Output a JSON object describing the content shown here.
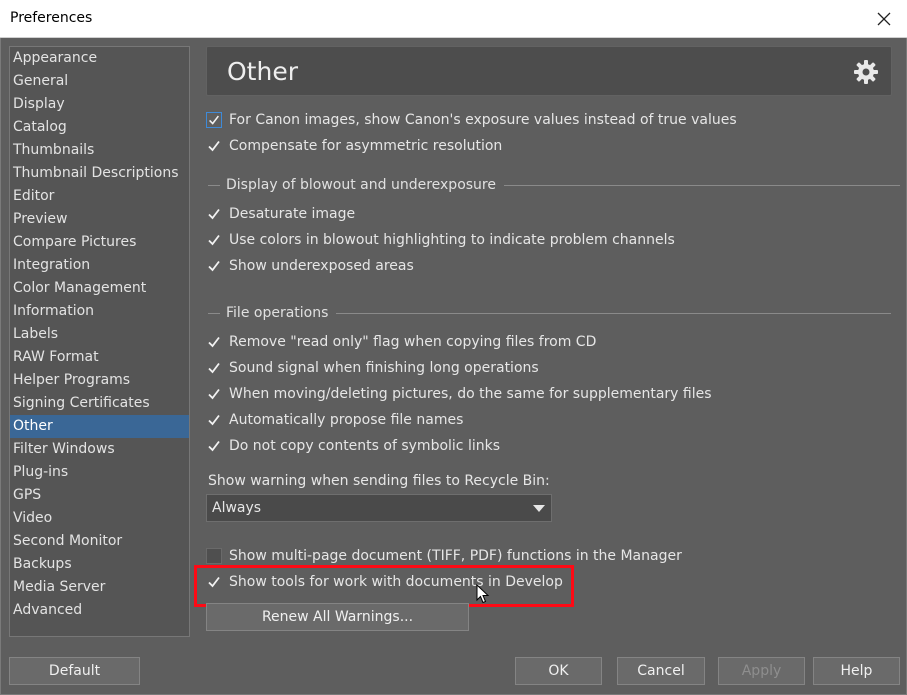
{
  "window": {
    "title": "Preferences"
  },
  "sidebar": {
    "items": [
      {
        "label": "Appearance"
      },
      {
        "label": "General"
      },
      {
        "label": "Display"
      },
      {
        "label": "Catalog"
      },
      {
        "label": "Thumbnails"
      },
      {
        "label": "Thumbnail Descriptions"
      },
      {
        "label": "Editor"
      },
      {
        "label": "Preview"
      },
      {
        "label": "Compare Pictures"
      },
      {
        "label": "Integration"
      },
      {
        "label": "Color Management"
      },
      {
        "label": "Information"
      },
      {
        "label": "Labels"
      },
      {
        "label": "RAW Format"
      },
      {
        "label": "Helper Programs"
      },
      {
        "label": "Signing Certificates"
      },
      {
        "label": "Other",
        "selected": true
      },
      {
        "label": "Filter Windows"
      },
      {
        "label": "Plug-ins"
      },
      {
        "label": "GPS"
      },
      {
        "label": "Video"
      },
      {
        "label": "Second Monitor"
      },
      {
        "label": "Backups"
      },
      {
        "label": "Media Server"
      },
      {
        "label": "Advanced"
      }
    ]
  },
  "header": {
    "title": "Other",
    "icon": "gear-icon"
  },
  "options": {
    "canon_exposure": {
      "label": "For Canon images, show Canon's exposure values instead of true values",
      "checked": true
    },
    "asymmetric": {
      "label": "Compensate for asymmetric resolution",
      "checked": true
    }
  },
  "blowout": {
    "heading": "Display of blowout and underexposure",
    "desaturate": {
      "label": "Desaturate image",
      "checked": true
    },
    "use_colors": {
      "label": "Use colors in blowout highlighting to indicate problem channels",
      "checked": true
    },
    "underexposed": {
      "label": "Show underexposed areas",
      "checked": true
    }
  },
  "fileops": {
    "heading": "File operations",
    "read_only": {
      "label": "Remove \"read only\" flag when copying files from CD",
      "checked": true
    },
    "sound": {
      "label": "Sound signal when finishing long operations",
      "checked": true
    },
    "supplementary": {
      "label": "When moving/deleting pictures, do the same for supplementary files",
      "checked": true
    },
    "propose_names": {
      "label": "Automatically propose file names",
      "checked": true
    },
    "symlinks": {
      "label": "Do not copy contents of symbolic links",
      "checked": true
    }
  },
  "recycle": {
    "label": "Show warning when sending files to Recycle Bin:",
    "selected": "Always"
  },
  "documents": {
    "multipage": {
      "label": "Show multi-page document (TIFF, PDF) functions in the Manager",
      "checked": false
    },
    "tools": {
      "label": "Show tools for work with documents in Develop",
      "checked": true
    }
  },
  "buttons": {
    "renew": "Renew All Warnings...",
    "default": "Default",
    "ok": "OK",
    "cancel": "Cancel",
    "apply": "Apply",
    "help": "Help"
  },
  "colors": {
    "accent": "#3a6796",
    "highlight_box": "#ff0a15"
  }
}
